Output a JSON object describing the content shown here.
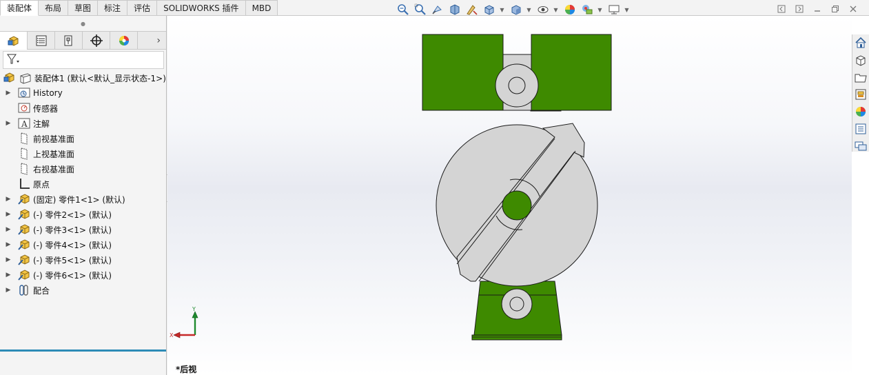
{
  "tabs": [
    {
      "label": "装配体",
      "active": true
    },
    {
      "label": "布局",
      "active": false
    },
    {
      "label": "草图",
      "active": false
    },
    {
      "label": "标注",
      "active": false
    },
    {
      "label": "评估",
      "active": false
    },
    {
      "label": "SOLIDWORKS 插件",
      "active": false
    },
    {
      "label": "MBD",
      "active": false
    }
  ],
  "hud_icons": [
    "zoom-to-fit-icon",
    "zoom-area-icon",
    "previous-view-icon",
    "section-view-icon",
    "dynamic-annotation-icon",
    "view-orientation-icon",
    "display-style-icon",
    "hide-show-icon",
    "edit-appearance-icon",
    "apply-scene-icon",
    "view-settings-icon"
  ],
  "panel_tabs": [
    "featuremanager-tab-icon",
    "propertymanager-tab-icon",
    "configurationmanager-tab-icon",
    "dimxpert-tab-icon",
    "displaymanager-tab-icon"
  ],
  "tree": {
    "root": "装配体1  (默认<默认_显示状态-1>)",
    "items": [
      {
        "label": "History",
        "expandable": true,
        "icon": "history-icon"
      },
      {
        "label": "传感器",
        "expandable": false,
        "icon": "sensor-icon"
      },
      {
        "label": "注解",
        "expandable": true,
        "icon": "annotation-icon"
      },
      {
        "label": "前视基准面",
        "expandable": false,
        "icon": "plane-icon"
      },
      {
        "label": "上视基准面",
        "expandable": false,
        "icon": "plane-icon"
      },
      {
        "label": "右视基准面",
        "expandable": false,
        "icon": "plane-icon"
      },
      {
        "label": "原点",
        "expandable": false,
        "icon": "origin-icon"
      },
      {
        "label": "(固定) 零件1<1> (默认)",
        "expandable": true,
        "icon": "part-icon"
      },
      {
        "label": "(-) 零件2<1> (默认)",
        "expandable": true,
        "icon": "part-icon"
      },
      {
        "label": "(-) 零件3<1> (默认)",
        "expandable": true,
        "icon": "part-icon"
      },
      {
        "label": "(-) 零件4<1> (默认)",
        "expandable": true,
        "icon": "part-icon"
      },
      {
        "label": "(-) 零件5<1> (默认)",
        "expandable": true,
        "icon": "part-icon"
      },
      {
        "label": "(-) 零件6<1> (默认)",
        "expandable": true,
        "icon": "part-icon"
      },
      {
        "label": "配合",
        "expandable": true,
        "icon": "mates-icon"
      }
    ]
  },
  "viewport": {
    "view_name": "*后视",
    "triad_x": "X",
    "triad_y": "Y"
  },
  "colors": {
    "part_green": "#3e8a00",
    "part_gray": "#d4d4d4",
    "accent_blue": "#2d8bb6",
    "edge": "#1a1a1a"
  },
  "task_pane_icons": [
    "home-icon",
    "design-library-icon",
    "file-explorer-icon",
    "view-palette-icon",
    "appearances-icon",
    "custom-properties-icon",
    "forum-icon"
  ]
}
